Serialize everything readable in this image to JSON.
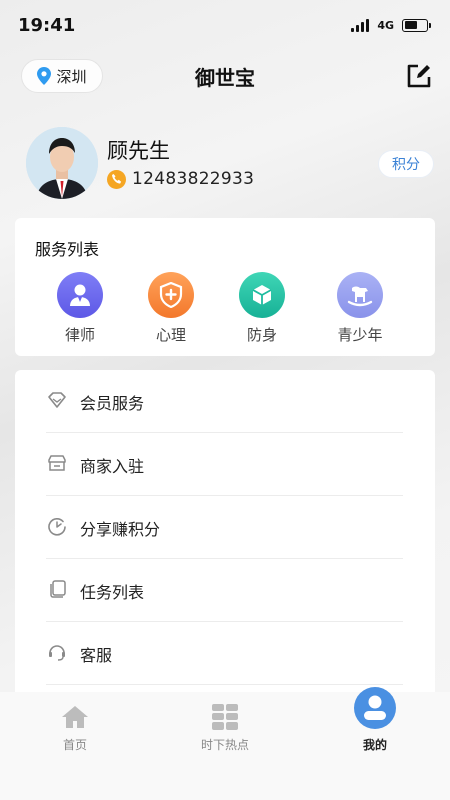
{
  "status_bar": {
    "time": "19:41",
    "network": "4G"
  },
  "header": {
    "city": "深圳",
    "title": "御世宝"
  },
  "profile": {
    "name": "顾先生",
    "phone": "12483822933",
    "points_label": "积分"
  },
  "services": {
    "title": "服务列表",
    "items": [
      {
        "label": "律师",
        "icon": "lawyer-icon",
        "color": "#6d6cf0"
      },
      {
        "label": "心理",
        "icon": "psychology-shield-icon",
        "color": "#f58a3c"
      },
      {
        "label": "防身",
        "icon": "cube-defense-icon",
        "color": "#27c4a6"
      },
      {
        "label": "青少年",
        "icon": "rocking-horse-icon",
        "color": "#9aa3ef"
      }
    ]
  },
  "menu": {
    "items": [
      {
        "label": "会员服务",
        "icon": "diamond-icon"
      },
      {
        "label": "商家入驻",
        "icon": "store-icon"
      },
      {
        "label": "分享赚积分",
        "icon": "share-refresh-icon"
      },
      {
        "label": "任务列表",
        "icon": "cards-icon"
      },
      {
        "label": "客服",
        "icon": "headset-icon"
      }
    ]
  },
  "tabs": [
    {
      "label": "首页",
      "icon": "home-icon",
      "active": false
    },
    {
      "label": "时下热点",
      "icon": "grid-icon",
      "active": false
    },
    {
      "label": "我的",
      "icon": "user-icon",
      "active": true
    }
  ],
  "colors": {
    "accent_blue": "#3b82d6",
    "phone_icon_orange": "#f5a623",
    "active_tab_blue": "#4a90e2"
  }
}
